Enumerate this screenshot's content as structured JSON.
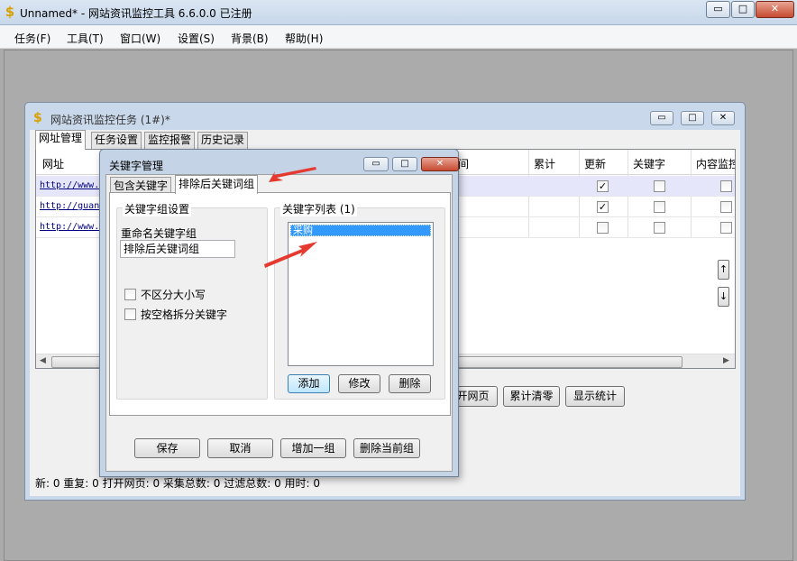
{
  "window": {
    "title": "Unnamed* - 网站资讯监控工具 6.6.0.0  已注册",
    "minimize": "▭",
    "maximize": "□",
    "close": "✕"
  },
  "menu": [
    "任务(F)",
    "工具(T)",
    "窗口(W)",
    "设置(S)",
    "背景(B)",
    "帮助(H)"
  ],
  "task_window": {
    "title": "网站资讯监控任务  (1#)*",
    "tabs": [
      "网址管理",
      "任务设置",
      "监控报警",
      "历史记录"
    ],
    "columns": [
      "网址",
      "间",
      "累计",
      "更新",
      "关键字",
      "内容监控"
    ],
    "rows": [
      {
        "url": "http://www.",
        "update": true,
        "keyword": false,
        "content": false
      },
      {
        "url": "http://guan",
        "update": true,
        "keyword": false,
        "content": false
      },
      {
        "url": "http://www.",
        "update": false,
        "keyword": false,
        "content": false
      }
    ],
    "move_up": "↑",
    "move_down": "↓",
    "buttons": {
      "open_page": "开网页",
      "clear_count": "累计清零",
      "show_stats": "显示统计"
    },
    "status": "新:  0   重复:  0   打开网页:  0   采集总数:  0   过滤总数:  0   用时:  0"
  },
  "dialog": {
    "title": "关键字管理",
    "tabs": [
      "包含关键字",
      "排除后关键词组"
    ],
    "group_settings": "关键字组设置",
    "rename_label": "重命名关键字组",
    "group_name_value": "排除后关键词组",
    "checkbox_case": "不区分大小写",
    "checkbox_split": "按空格拆分关键字",
    "list_label": "关键字列表 (1)",
    "list_items": [
      "采购"
    ],
    "btn_add": "添加",
    "btn_edit": "修改",
    "btn_delete": "删除",
    "btn_save": "保存",
    "btn_cancel": "取消",
    "btn_add_group": "增加一组",
    "btn_delete_group": "删除当前组"
  },
  "colors": {
    "annotation_arrow": "#e53a30",
    "selection": "#3399ff",
    "row_highlight": "#e6e6fa"
  }
}
